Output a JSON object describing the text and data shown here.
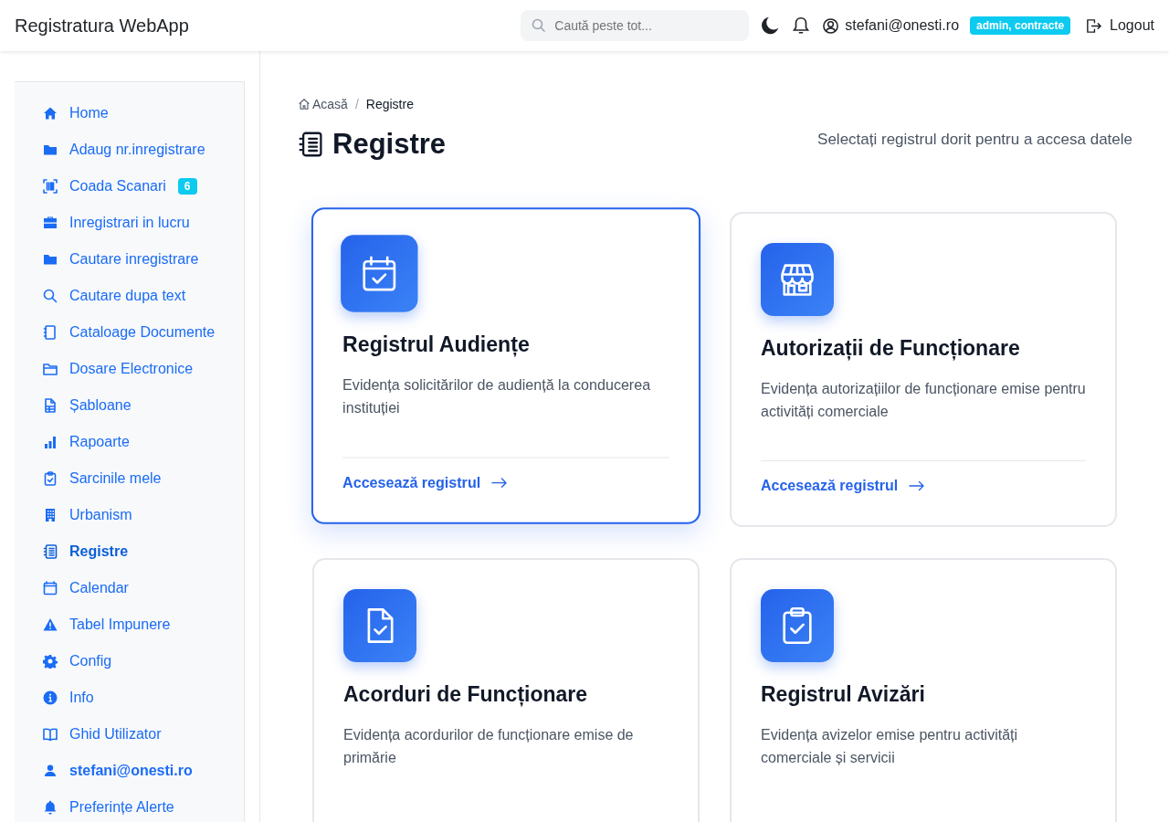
{
  "header": {
    "title": "Registratura WebApp",
    "search": {
      "placeholder": "Caută peste tot..."
    },
    "user": "stefani@onesti.ro",
    "roles": "admin, contracte",
    "logout": "Logout"
  },
  "sidebar": {
    "items": [
      {
        "label": "Home",
        "selected": false
      },
      {
        "label": "Adaug nr.inregistrare",
        "selected": false
      },
      {
        "label": "Coada Scanari",
        "selected": false,
        "badge": "6"
      },
      {
        "label": "Inregistrari in lucru",
        "selected": false
      },
      {
        "label": "Cautare inregistrare",
        "selected": false
      },
      {
        "label": "Cautare dupa text",
        "selected": false
      },
      {
        "label": "Cataloage Documente",
        "selected": false
      },
      {
        "label": "Dosare Electronice",
        "selected": false
      },
      {
        "label": "Șabloane",
        "selected": false
      },
      {
        "label": "Rapoarte",
        "selected": false
      },
      {
        "label": "Sarcinile mele",
        "selected": false
      },
      {
        "label": "Urbanism",
        "selected": false
      },
      {
        "label": "Registre",
        "selected": true
      },
      {
        "label": "Calendar",
        "selected": false
      },
      {
        "label": "Tabel Impunere",
        "selected": false
      },
      {
        "label": "Config",
        "selected": false
      },
      {
        "label": "Info",
        "selected": false
      },
      {
        "label": "Ghid Utilizator",
        "selected": false
      },
      {
        "label": "stefani@onesti.ro",
        "selected": false,
        "kind": "user"
      },
      {
        "label": "Preferințe Alerte",
        "selected": false
      }
    ]
  },
  "breadcrumb": {
    "separator": "/",
    "items": [
      {
        "label": "Acasă"
      },
      {
        "label": "Registre"
      }
    ]
  },
  "page": {
    "title": "Registre",
    "subtitle": "Selectați registrul dorit pentru a accesa datele"
  },
  "cards": [
    {
      "title": "Registrul Audiențe",
      "description": "Evidența solicitărilor de audiență la conducerea instituției",
      "link": "Accesează registrul",
      "selected": true
    },
    {
      "title": "Autorizații de Funcționare",
      "description": "Evidența autorizațiilor de funcționare emise pentru activități comerciale",
      "link": "Accesează registrul",
      "selected": false
    },
    {
      "title": "Acorduri de Funcționare",
      "description": "Evidența acordurilor de funcționare emise de primărie",
      "selected": false
    },
    {
      "title": "Registrul Avizări",
      "description": "Evidența avizelor emise pentru activități comerciale și servicii",
      "selected": false
    }
  ]
}
